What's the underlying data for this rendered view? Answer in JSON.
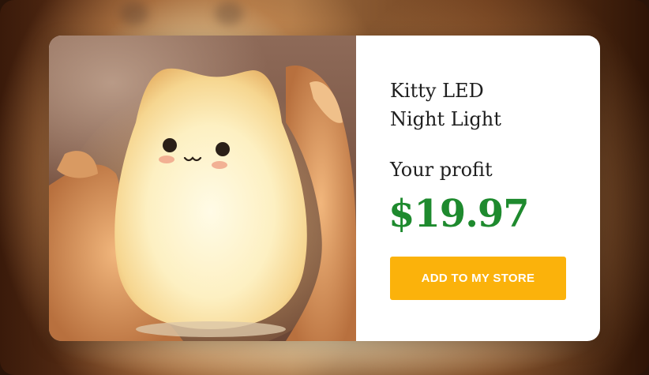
{
  "product": {
    "title": "Kitty LED\nNight Light",
    "profit_label": "Your profit",
    "profit_value": "$19.97",
    "add_button_label": "ADD TO MY STORE",
    "image_icon": "kitty-led-lamp-photo"
  },
  "colors": {
    "price": "#1e8a2e",
    "button": "#fbb20b",
    "button_text": "#ffffff"
  }
}
